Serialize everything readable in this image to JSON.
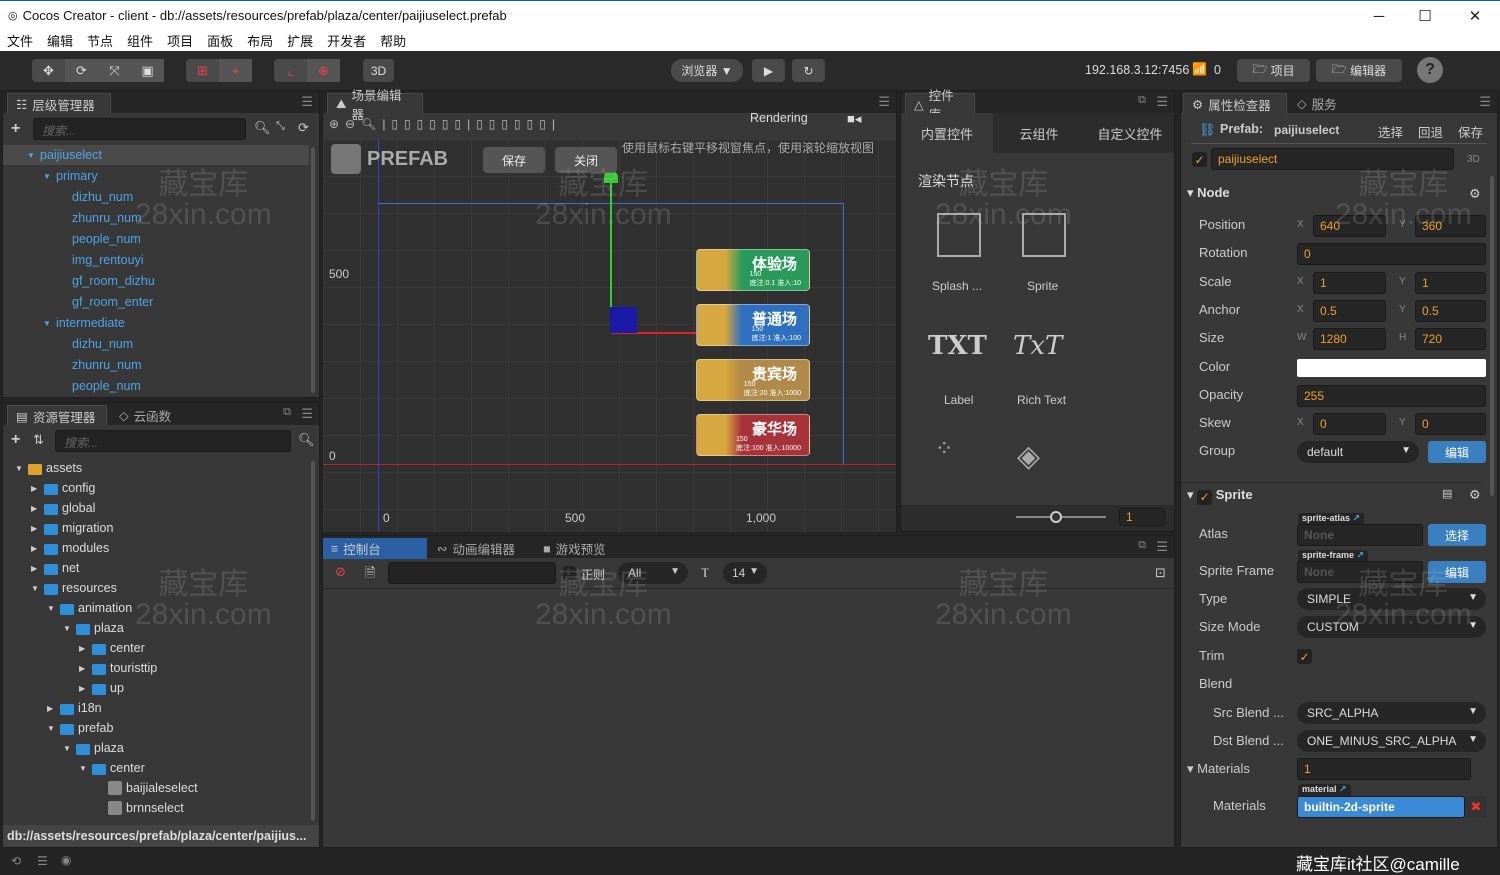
{
  "window": {
    "title": "Cocos Creator - client - db://assets/resources/prefab/plaza/center/paijiuselect.prefab",
    "minimize": "─",
    "maximize": "☐",
    "close": "✕"
  },
  "menu": [
    "文件",
    "编辑",
    "节点",
    "组件",
    "项目",
    "面板",
    "布局",
    "扩展",
    "开发者",
    "帮助"
  ],
  "toolbar": {
    "mode_3d": "3D",
    "browser": "浏览器 ▼",
    "play": "▶",
    "refresh": "↻",
    "ip": "192.168.3.12:7456",
    "connections": "0",
    "project": "项目",
    "editor": "编辑器",
    "help": "?"
  },
  "hierarchy": {
    "tab": "层级管理器",
    "search_placeholder": "搜索...",
    "items": [
      {
        "label": "paijiuselect",
        "level": 0,
        "expanded": true,
        "selected": true
      },
      {
        "label": "primary",
        "level": 1,
        "expanded": true
      },
      {
        "label": "dizhu_num",
        "level": 2
      },
      {
        "label": "zhunru_num",
        "level": 2
      },
      {
        "label": "people_num",
        "level": 2
      },
      {
        "label": "img_rentouyi",
        "level": 2
      },
      {
        "label": "gf_room_dizhu",
        "level": 2
      },
      {
        "label": "gf_room_enter",
        "level": 2
      },
      {
        "label": "intermediate",
        "level": 1,
        "expanded": true
      },
      {
        "label": "dizhu_num",
        "level": 2
      },
      {
        "label": "zhunru_num",
        "level": 2
      },
      {
        "label": "people_num",
        "level": 2
      }
    ]
  },
  "assets": {
    "tab": "资源管理器",
    "tab2": "云函数",
    "search_placeholder": "搜索...",
    "path": "db://assets/resources/prefab/plaza/center/paijius...",
    "items": [
      {
        "label": "assets",
        "level": 0,
        "type": "root",
        "expanded": true
      },
      {
        "label": "config",
        "level": 1,
        "type": "folder"
      },
      {
        "label": "global",
        "level": 1,
        "type": "folder"
      },
      {
        "label": "migration",
        "level": 1,
        "type": "folder"
      },
      {
        "label": "modules",
        "level": 1,
        "type": "folder"
      },
      {
        "label": "net",
        "level": 1,
        "type": "folder"
      },
      {
        "label": "resources",
        "level": 1,
        "type": "folder",
        "expanded": true
      },
      {
        "label": "animation",
        "level": 2,
        "type": "folder",
        "expanded": true
      },
      {
        "label": "plaza",
        "level": 3,
        "type": "folder",
        "expanded": true
      },
      {
        "label": "center",
        "level": 4,
        "type": "folder"
      },
      {
        "label": "touristtip",
        "level": 4,
        "type": "folder"
      },
      {
        "label": "up",
        "level": 4,
        "type": "folder"
      },
      {
        "label": "i18n",
        "level": 2,
        "type": "folder"
      },
      {
        "label": "prefab",
        "level": 2,
        "type": "folder",
        "expanded": true
      },
      {
        "label": "plaza",
        "level": 3,
        "type": "folder",
        "expanded": true
      },
      {
        "label": "center",
        "level": 4,
        "type": "folder",
        "expanded": true
      },
      {
        "label": "baijialeselect",
        "level": 5,
        "type": "prefab"
      },
      {
        "label": "brnnselect",
        "level": 5,
        "type": "prefab"
      }
    ]
  },
  "scene": {
    "tab": "场景编辑器",
    "rendering": "Rendering",
    "prefab_label": "PREFAB",
    "save": "保存",
    "close": "关闭",
    "hint": "使用鼠标右键平移视窗焦点，使用滚轮缩放视图",
    "axis_x": [
      "0",
      "500",
      "1,000"
    ],
    "axis_y": [
      "500",
      "0"
    ],
    "cards": [
      {
        "title": "体验场",
        "people": "150",
        "info": "底注:0.1 准入:10",
        "color": "#2a9a5a"
      },
      {
        "title": "普通场",
        "people": "150",
        "info": "底注:1 准入:100",
        "color": "#2f6fc0"
      },
      {
        "title": "贵宾场",
        "people": "150",
        "info": "底注:20 准入:1000",
        "color": "#b08a48"
      },
      {
        "title": "豪华场",
        "people": "150",
        "info": "底注:100 准入:10000",
        "color": "#a8323a"
      }
    ]
  },
  "widgets": {
    "tab": "控件库",
    "tabs": [
      "内置控件",
      "云组件",
      "自定义控件"
    ],
    "section": "渲染节点",
    "items": [
      "Splash ...",
      "Sprite",
      "Label",
      "Rich Text"
    ],
    "label_glyph": "TXT",
    "richtext_glyph": "TxT",
    "zoom_value": "1"
  },
  "console": {
    "tabs": [
      "控制台",
      "动画编辑器",
      "游戏预览"
    ],
    "regex": "正则",
    "level": "All",
    "font_size": "14"
  },
  "inspector": {
    "tab": "属性检查器",
    "tab2": "服务",
    "prefab_label": "Prefab:",
    "prefab_name": "paijiuselect",
    "select": "选择",
    "revert": "回退",
    "save": "保存",
    "node_name": "paijiuselect",
    "mode": "3D",
    "node_section": "Node",
    "position": {
      "label": "Position",
      "x": "640",
      "y": "360"
    },
    "rotation": {
      "label": "Rotation",
      "value": "0"
    },
    "scale": {
      "label": "Scale",
      "x": "1",
      "y": "1"
    },
    "anchor": {
      "label": "Anchor",
      "x": "0.5",
      "y": "0.5"
    },
    "size": {
      "label": "Size",
      "w": "1280",
      "h": "720"
    },
    "color": {
      "label": "Color",
      "value": "#ffffff"
    },
    "opacity": {
      "label": "Opacity",
      "value": "255"
    },
    "skew": {
      "label": "Skew",
      "x": "0",
      "y": "0"
    },
    "group": {
      "label": "Group",
      "value": "default",
      "edit": "编辑"
    },
    "sprite_section": "Sprite",
    "atlas": {
      "label": "Atlas",
      "tag": "sprite-atlas",
      "value": "None",
      "button": "选择"
    },
    "sprite_frame": {
      "label": "Sprite Frame",
      "tag": "sprite-frame",
      "value": "None",
      "button": "编辑"
    },
    "type": {
      "label": "Type",
      "value": "SIMPLE"
    },
    "size_mode": {
      "label": "Size Mode",
      "value": "CUSTOM"
    },
    "trim": {
      "label": "Trim",
      "checked": true
    },
    "blend": {
      "label": "Blend"
    },
    "src_blend": {
      "label": "Src Blend ...",
      "value": "SRC_ALPHA"
    },
    "dst_blend": {
      "label": "Dst Blend ...",
      "value": "ONE_MINUS_SRC_ALPHA"
    },
    "materials": {
      "label": "Materials",
      "count": "1",
      "item_label": "Materials",
      "tag": "material",
      "value": "builtin-2d-sprite"
    }
  },
  "watermark": {
    "line1": "藏宝库",
    "line2": "28xin.com",
    "footer": "藏宝库it社区@camille"
  },
  "colors": {
    "accent": "#f0a030",
    "link": "#4ca5e8",
    "button": "#3a7fc0"
  }
}
